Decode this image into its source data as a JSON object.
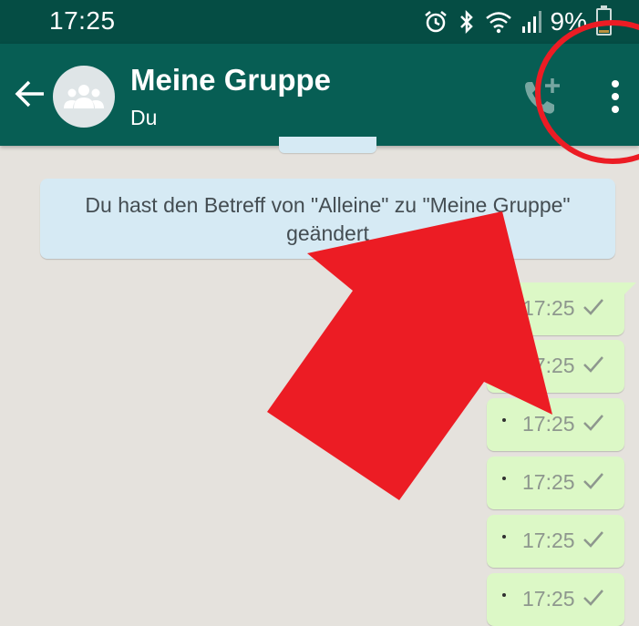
{
  "status_bar": {
    "time": "17:25",
    "battery_percent": "9%",
    "icons": [
      "alarm-icon",
      "bluetooth-icon",
      "wifi-icon",
      "signal-icon",
      "battery-icon"
    ]
  },
  "header": {
    "title": "Meine Gruppe",
    "subtitle": "Du",
    "icons": [
      "back-arrow-icon",
      "group-avatar-icon",
      "add-call-icon",
      "more-options-icon"
    ]
  },
  "system_message": {
    "text": "Du hast den Betreff von \"Alleine\" zu \"Meine Gruppe\" geändert"
  },
  "messages": [
    {
      "text": "",
      "time": "17:25",
      "status": "sent"
    },
    {
      "text": "",
      "time": "17:25",
      "status": "sent"
    },
    {
      "text": "",
      "time": "17:25",
      "status": "sent"
    },
    {
      "text": "",
      "time": "17:25",
      "status": "sent"
    },
    {
      "text": "",
      "time": "17:25",
      "status": "sent"
    },
    {
      "text": "",
      "time": "17:25",
      "status": "sent"
    }
  ],
  "annotations": [
    "red-arrow",
    "red-circle"
  ],
  "colors": {
    "appbar": "#075e54",
    "statusbar": "#054d44",
    "background": "#e5e2dd",
    "outgoing_bubble": "#dcf8c6",
    "system_bubble": "#d6eaf4",
    "annotation_red": "#ec1c24"
  }
}
